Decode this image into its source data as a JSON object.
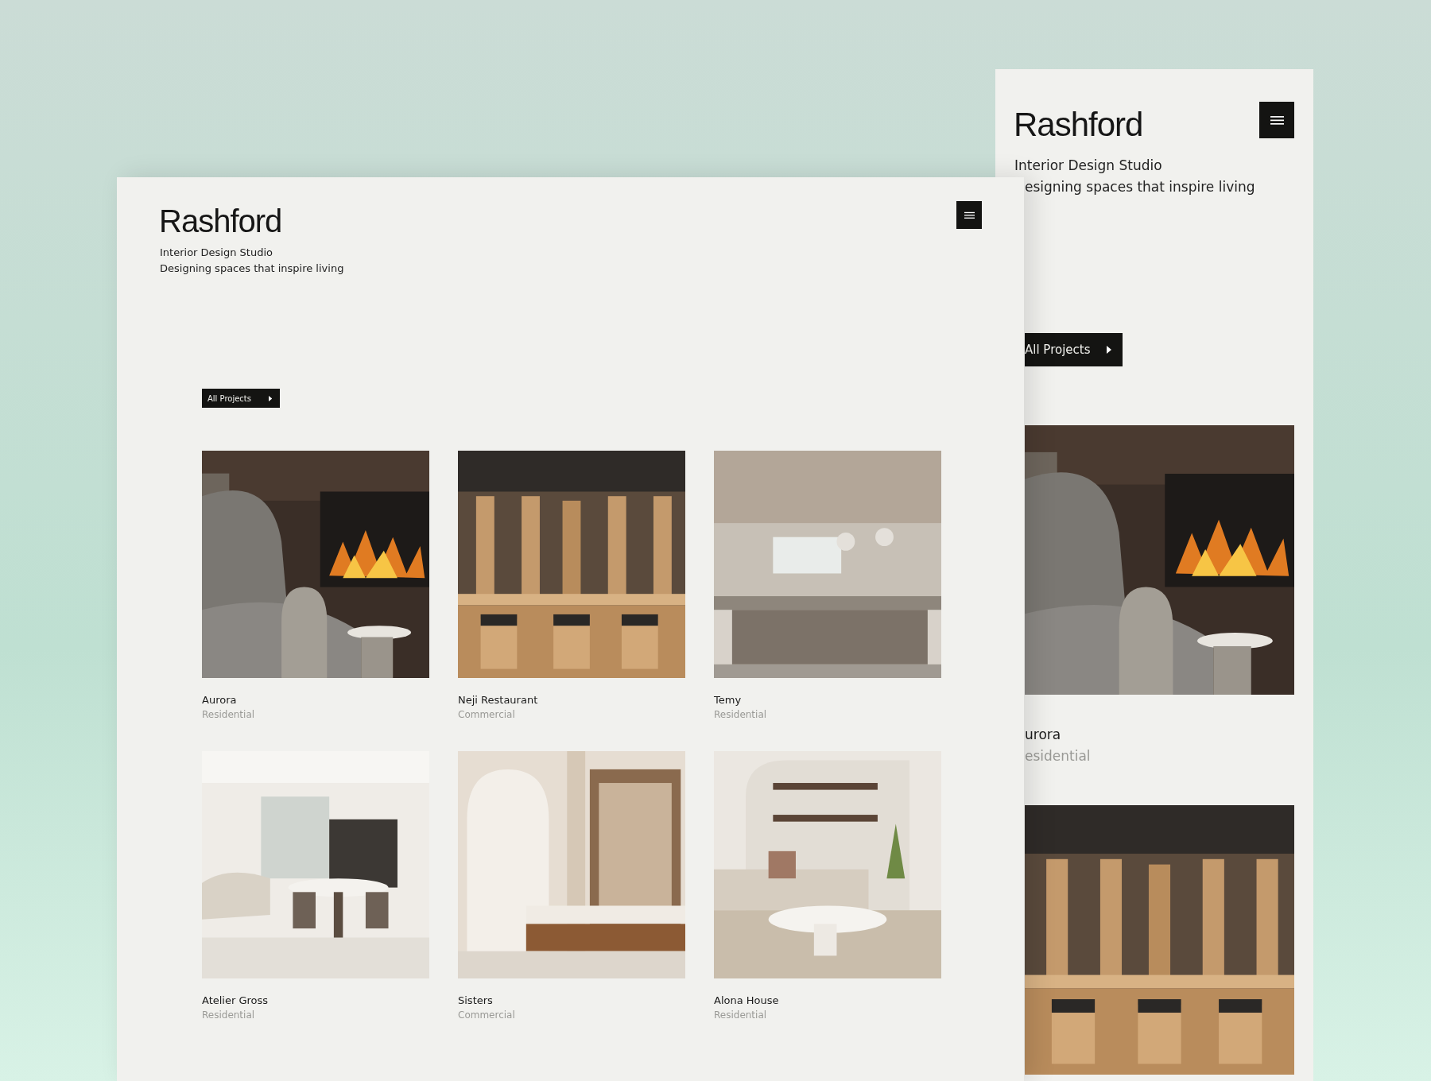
{
  "desktop": {
    "logo": "Rashford",
    "tagline": [
      "Interior Design Studio",
      "Designing spaces that inspire living"
    ],
    "filter_button": "All Projects",
    "projects": [
      {
        "title": "Aurora",
        "category": "Residential"
      },
      {
        "title": "Neji Restaurant",
        "category": "Commercial"
      },
      {
        "title": "Temy",
        "category": "Residential"
      },
      {
        "title": "Atelier Gross",
        "category": "Residential"
      },
      {
        "title": "Sisters",
        "category": "Commercial"
      },
      {
        "title": "Alona House",
        "category": "Residential"
      }
    ]
  },
  "mobile": {
    "logo": "Rashford",
    "tagline": [
      "Interior Design Studio",
      "esigning spaces that inspire living"
    ],
    "filter_button": "All Projects",
    "projects": [
      {
        "title": "urora",
        "category": "esidential"
      },
      {
        "kind": "picture"
      }
    ]
  }
}
